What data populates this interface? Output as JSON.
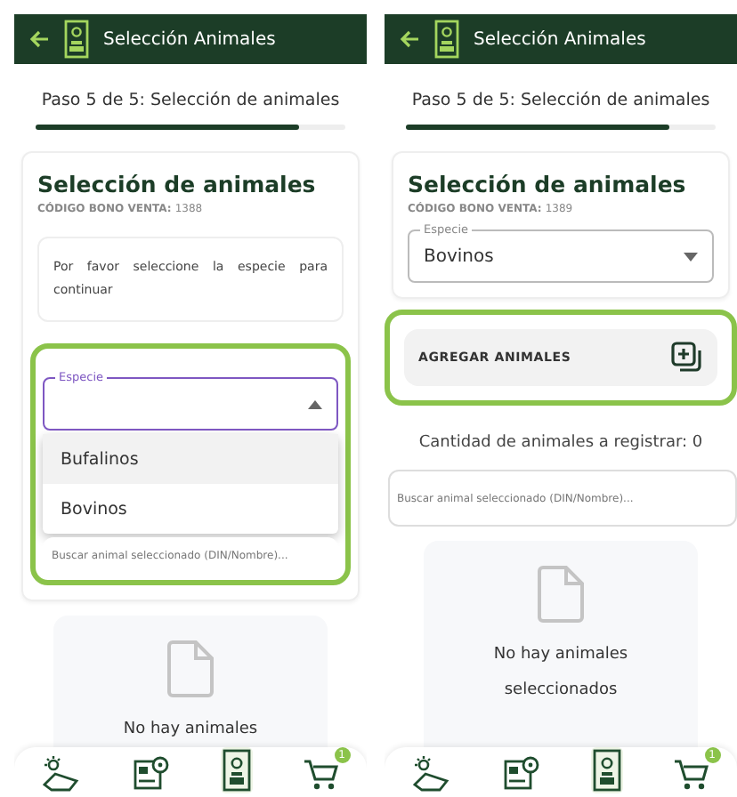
{
  "screens": [
    {
      "header": {
        "title": "Selección Animales"
      },
      "step": {
        "label": "Paso 5 de 5: Selección de animales",
        "level": 0.85
      },
      "card": {
        "title": "Selección de animales",
        "code_label": "CÓDIGO BONO VENTA:",
        "code_value": "1388"
      },
      "info_text": "Por favor seleccione la especie para continuar",
      "species": {
        "label": "Especie",
        "focused": true,
        "open": true,
        "highlighted": true,
        "options": [
          {
            "label": "Bufalinos",
            "selected": true
          },
          {
            "label": "Bovinos",
            "selected": false
          }
        ]
      },
      "search": {
        "placeholder": "Buscar animal seleccionado (DIN/Nombre)..."
      },
      "empty_state": {
        "text": "No hay animales"
      },
      "nav": [
        {
          "kind": "weather",
          "selected": false
        },
        {
          "kind": "map",
          "selected": false
        },
        {
          "kind": "receipt",
          "selected": true
        },
        {
          "kind": "cart",
          "selected": false,
          "badge": "1"
        }
      ]
    },
    {
      "header": {
        "title": "Selección Animales"
      },
      "step": {
        "label": "Paso 5 de 5: Selección de animales",
        "level": 0.85
      },
      "card": {
        "title": "Selección de animales",
        "code_label": "CÓDIGO BONO VENTA:",
        "code_value": "1389"
      },
      "species": {
        "label": "Especie",
        "value": "Bovinos",
        "focused": false,
        "open": false,
        "highlighted": false
      },
      "add_button": {
        "label": "AGREGAR ANIMALES",
        "highlighted": true
      },
      "count_text": "Cantidad de animales a registrar: 0",
      "search": {
        "placeholder": "Buscar animal seleccionado (DIN/Nombre)..."
      },
      "empty_state": {
        "text": "No hay animales seleccionados"
      },
      "nav": [
        {
          "kind": "weather",
          "selected": false
        },
        {
          "kind": "map",
          "selected": false
        },
        {
          "kind": "receipt",
          "selected": true
        },
        {
          "kind": "cart",
          "selected": false,
          "badge": "1"
        }
      ]
    }
  ]
}
